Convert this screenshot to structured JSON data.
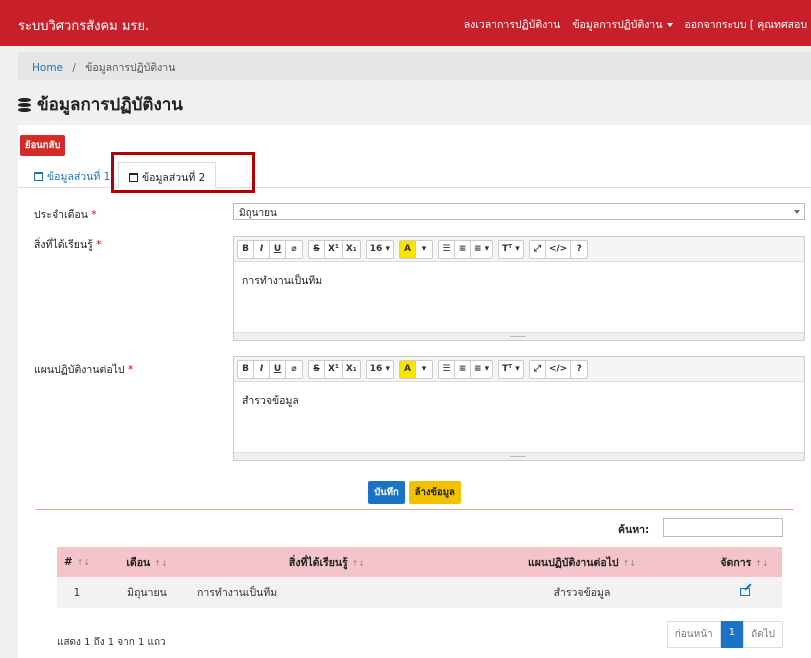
{
  "nav": {
    "brand": "ระบบวิศวกรสังคม มรย.",
    "item1": "ลงเวลาการปฏิบัติงาน",
    "item2": "ข้อมูลการปฏิบัติงาน",
    "item3": "ออกจากระบบ [ คุณทศสอบ"
  },
  "breadcrumb": {
    "home": "Home",
    "separator": "/",
    "current": "ข้อมูลการปฏิบัติงาน"
  },
  "page": {
    "title": "ข้อมูลการปฏิบัติงาน"
  },
  "back_button": "ย้อนกลับ",
  "tabs": {
    "tab1": "ข้อมูลส่วนที่ 1",
    "tab2": "ข้อมูลส่วนที่ 2"
  },
  "form": {
    "month": {
      "label": "ประจำเดือน",
      "value": "มิถุนายน"
    },
    "learned": {
      "label": "สิ่งที่ได้เรียนรู้",
      "value": "การทำงานเป็นทีม"
    },
    "plan": {
      "label": "แผนปฏิบัติงานต่อไป",
      "value": "สำรวจข้อมูล"
    },
    "required_mark": "*"
  },
  "toolbar": {
    "bold": "B",
    "italic": "I",
    "underline": "U",
    "eraser": "⌀",
    "strike": "S",
    "superscript": "X¹",
    "subscript": "X₁",
    "fontsize": "16 ▾",
    "color": "A",
    "color_arrow": "▾",
    "ul": "☰",
    "ol": "≡",
    "align": "≡ ▾",
    "textheight": "Tᵀ ▾",
    "fullscreen": "⤢",
    "code": "</>",
    "help": "?"
  },
  "buttons": {
    "save": "บันทึก",
    "clear": "ล้างข้อมูล"
  },
  "search": {
    "label": "ค้นหา:",
    "value": ""
  },
  "table": {
    "headers": [
      "#",
      "เดือน",
      "สิ่งที่ได้เรียนรู้",
      "แผนปฏิบัติงานต่อไป",
      "จัดการ"
    ],
    "rows": [
      {
        "no": "1",
        "month": "มิถุนายน",
        "learned": "การทำงานเป็นทีม",
        "plan": "สำรวจข้อมูล"
      }
    ]
  },
  "pagination": {
    "info": "แสดง 1 ถึง 1 จาก 1 แถว",
    "prev": "ก่อนหน้า",
    "page": "1",
    "next": "ถัดไป"
  },
  "colors": {
    "nav": "#c8202a",
    "primary": "#1a73c4",
    "table_header": "#f5c4cb",
    "highlight_box": "#b40000"
  }
}
